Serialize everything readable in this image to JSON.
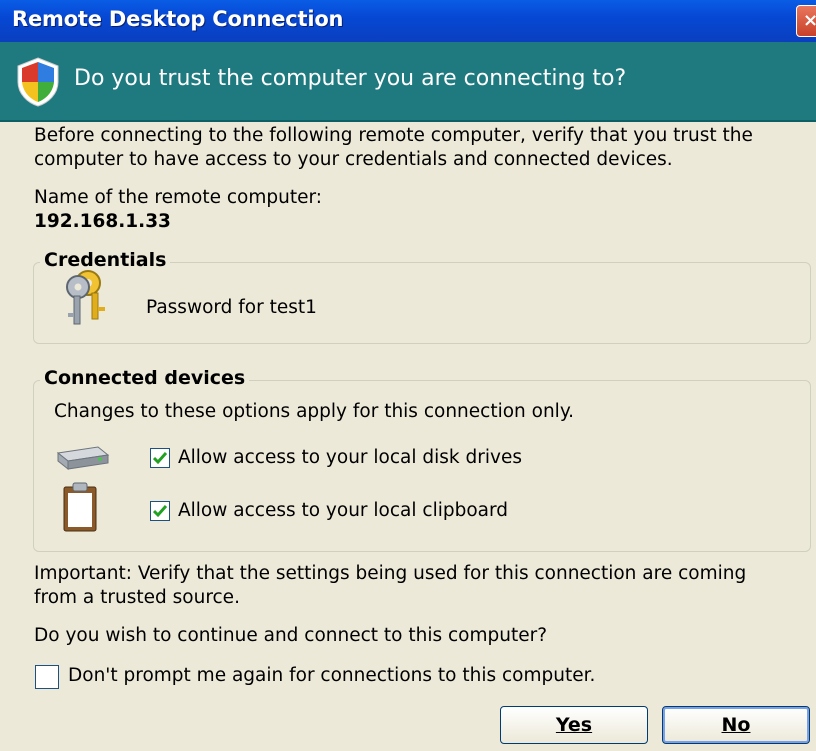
{
  "window": {
    "title": "Remote Desktop Connection",
    "close_label": "×"
  },
  "banner": {
    "text": "Do you trust the computer you are connecting to?"
  },
  "intro": {
    "line1": "Before connecting to the following remote computer, verify that you trust the",
    "line2": "computer to have access to your credentials and connected devices."
  },
  "remote": {
    "label": "Name of the remote computer:",
    "value": "192.168.1.33"
  },
  "credentials": {
    "legend": "Credentials",
    "text": "Password for test1"
  },
  "devices": {
    "legend": "Connected devices",
    "note": "Changes to these options apply for this connection only.",
    "disk_label": "Allow access to your local disk drives",
    "clipboard_label": "Allow access to your local clipboard",
    "disk_checked": true,
    "clipboard_checked": true
  },
  "important": {
    "line1": "Important: Verify that the settings being used for this connection are coming",
    "line2": "from a trusted source."
  },
  "question": "Do you wish to continue and connect to this computer?",
  "dont_prompt": {
    "label": "Don't prompt me again for connections to this computer.",
    "checked": false
  },
  "buttons": {
    "yes": "Yes",
    "no": "No"
  },
  "colors": {
    "title_bar": "#0648d4",
    "banner": "#1f7a80",
    "background": "#ece9d8",
    "check": "#21a121"
  }
}
